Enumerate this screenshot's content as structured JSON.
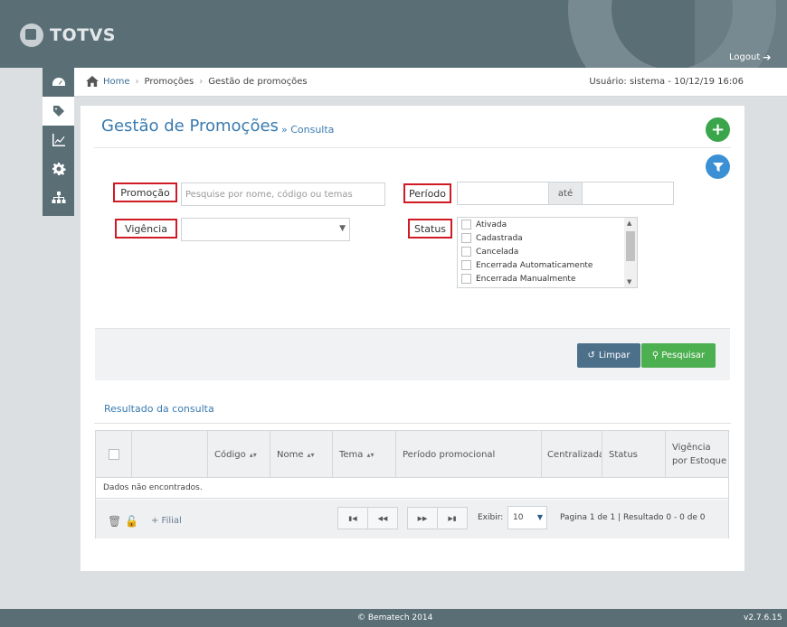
{
  "header": {
    "brand": "TOTVS",
    "logout_label": "Logout"
  },
  "nav": {
    "items": [
      "dashboard-icon",
      "tag-icon",
      "chart-icon",
      "gear-icon",
      "org-icon"
    ],
    "active_index": 1
  },
  "breadcrumb": {
    "home": "Home",
    "items": [
      "Promoções",
      "Gestão de promoções"
    ]
  },
  "user_info": "Usuário: sistema - 10/12/19 16:06",
  "page": {
    "title": "Gestão de Promoções",
    "subtitle": "» Consulta"
  },
  "filters": {
    "promocao_label": "Promoção",
    "promocao_placeholder": "Pesquise por nome, código ou temas",
    "periodo_label": "Período",
    "periodo_ate": "até",
    "vigencia_label": "Vigência",
    "vigencia_value": "",
    "status_label": "Status",
    "status_options": [
      "Ativada",
      "Cadastrada",
      "Cancelada",
      "Encerrada Automaticamente",
      "Encerrada Manualmente"
    ]
  },
  "actions": {
    "limpar": "Limpar",
    "pesquisar": "Pesquisar"
  },
  "results": {
    "title": "Resultado da consulta",
    "columns": [
      "Código",
      "Nome",
      "Tema",
      "Período promocional",
      "Centralizada",
      "Status",
      "Vigência por Estoque"
    ],
    "empty_message": "Dados não encontrados.",
    "filial_label": "+ Filial",
    "exibir_label": "Exibir:",
    "page_size": "10",
    "page_info": "Pagina 1 de 1 | Resultado 0 - 0 de 0"
  },
  "footer": {
    "copyright": "© Bematech 2014",
    "version": "v2.7.6.15"
  },
  "colors": {
    "header": "#5a6e76",
    "title_blue": "#3a7bb0",
    "add_green": "#3aa54a",
    "filter_blue": "#3b8fd4",
    "label_border_red": "#d01b25",
    "limpar_btn": "#4c6f8a",
    "pesquisar_btn": "#4caf50"
  }
}
